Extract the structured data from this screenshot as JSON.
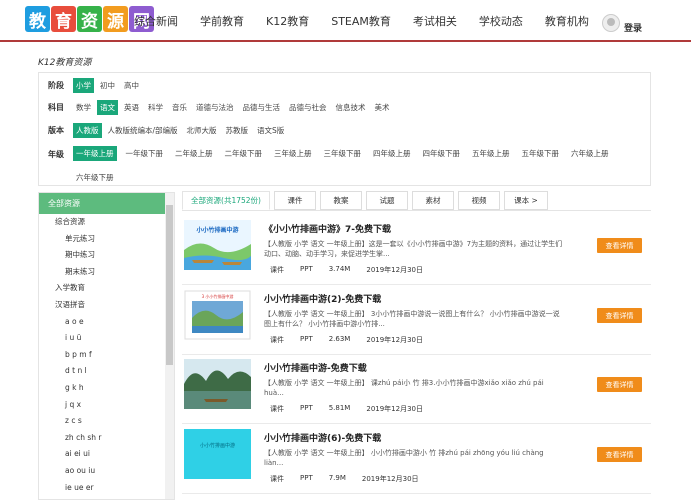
{
  "header": {
    "logo": [
      {
        "char": "教",
        "color": "#1e9de0"
      },
      {
        "char": "育",
        "color": "#e84d3c"
      },
      {
        "char": "资",
        "color": "#36b24a"
      },
      {
        "char": "源",
        "color": "#f29c1f"
      },
      {
        "char": "网",
        "color": "#8e5cd0"
      }
    ],
    "nav": [
      "综合新闻",
      "学前教育",
      "K12教育",
      "STEAM教育",
      "考试相关",
      "学校动态",
      "教育机构"
    ],
    "login": "登录"
  },
  "page_title": "K12教育资源",
  "filters": {
    "stage": {
      "label": "阶段",
      "options": [
        "小学",
        "初中",
        "高中"
      ],
      "selected": 0
    },
    "subject": {
      "label": "科目",
      "options": [
        "数学",
        "语文",
        "英语",
        "科学",
        "音乐",
        "道德与法治",
        "品德与生活",
        "品德与社会",
        "信息技术",
        "美术"
      ],
      "selected": 1
    },
    "edition": {
      "label": "版本",
      "options": [
        "人教版",
        "人教版统编本/部编版",
        "北师大版",
        "苏教版",
        "语文S版"
      ],
      "selected": 0
    },
    "grade": {
      "label": "年级",
      "options": [
        "一年级上册",
        "一年级下册",
        "二年级上册",
        "二年级下册",
        "三年级上册",
        "三年级下册",
        "四年级上册",
        "四年级下册",
        "五年级上册",
        "五年级下册",
        "六年级上册",
        "六年级下册"
      ],
      "selected": 0
    }
  },
  "sidebar": {
    "head": "全部资源",
    "items": [
      {
        "label": "综合资源",
        "level": 1
      },
      {
        "label": "单元练习",
        "level": 2
      },
      {
        "label": "期中练习",
        "level": 2
      },
      {
        "label": "期末练习",
        "level": 2
      },
      {
        "label": "入学教育",
        "level": 1
      },
      {
        "label": "汉语拼音",
        "level": 1
      },
      {
        "label": "a o e",
        "level": 2
      },
      {
        "label": "i u ü",
        "level": 2
      },
      {
        "label": "b p m f",
        "level": 2
      },
      {
        "label": "d t n l",
        "level": 2
      },
      {
        "label": "g k h",
        "level": 2
      },
      {
        "label": "j q x",
        "level": 2
      },
      {
        "label": "z c s",
        "level": 2
      },
      {
        "label": "zh ch sh r",
        "level": 2
      },
      {
        "label": "ai ei ui",
        "level": 2
      },
      {
        "label": "ao ou iu",
        "level": 2
      },
      {
        "label": "ie ue er",
        "level": 2
      }
    ]
  },
  "tabs": [
    "全部资源(共1752份)",
    "课件",
    "教案",
    "试题",
    "素材",
    "视频",
    "课本 >"
  ],
  "resources": [
    {
      "title": "《小小竹排画中游》7-免费下载",
      "desc": "【人教版 小学 语文 一年级上册】这是一套以《小小竹排画中游》7为主题的资料，通过让学生们动口、动脑、动手学习，来促进学生掌...",
      "type": "课件",
      "format": "PPT",
      "size": "3.74M",
      "date": "2019年12月30日",
      "button": "查看详情",
      "thumb_text": "小小竹排画中游"
    },
    {
      "title": "小小竹排画中游(2)-免费下载",
      "desc": "【人教版 小学 语文 一年级上册】 3小小竹排画中游说一说图上有什么？ 小小竹排画中游说一说图上有什么？ 小小竹排画中游小竹排...",
      "type": "课件",
      "format": "PPT",
      "size": "2.63M",
      "date": "2019年12月30日",
      "button": "查看详情",
      "thumb_text": "3 小小竹排画中游"
    },
    {
      "title": "小小竹排画中游-免费下载",
      "desc": "【人教版 小学 语文 一年级上册】 课zhú pái小 竹 排3.小小竹排画中游xiǎo xiǎo zhú pái huà...",
      "type": "课件",
      "format": "PPT",
      "size": "5.81M",
      "date": "2019年12月30日",
      "button": "查看详情",
      "thumb_text": ""
    },
    {
      "title": "小小竹排画中游(6)-免费下载",
      "desc": "【人教版 小学 语文 一年级上册】 小小竹排画中游小 竹 排zhú pái zhōng yóu liú chàng liàn...",
      "type": "课件",
      "format": "PPT",
      "size": "7.9M",
      "date": "2019年12月30日",
      "button": "查看详情",
      "thumb_text": "小小竹排画中游"
    }
  ]
}
